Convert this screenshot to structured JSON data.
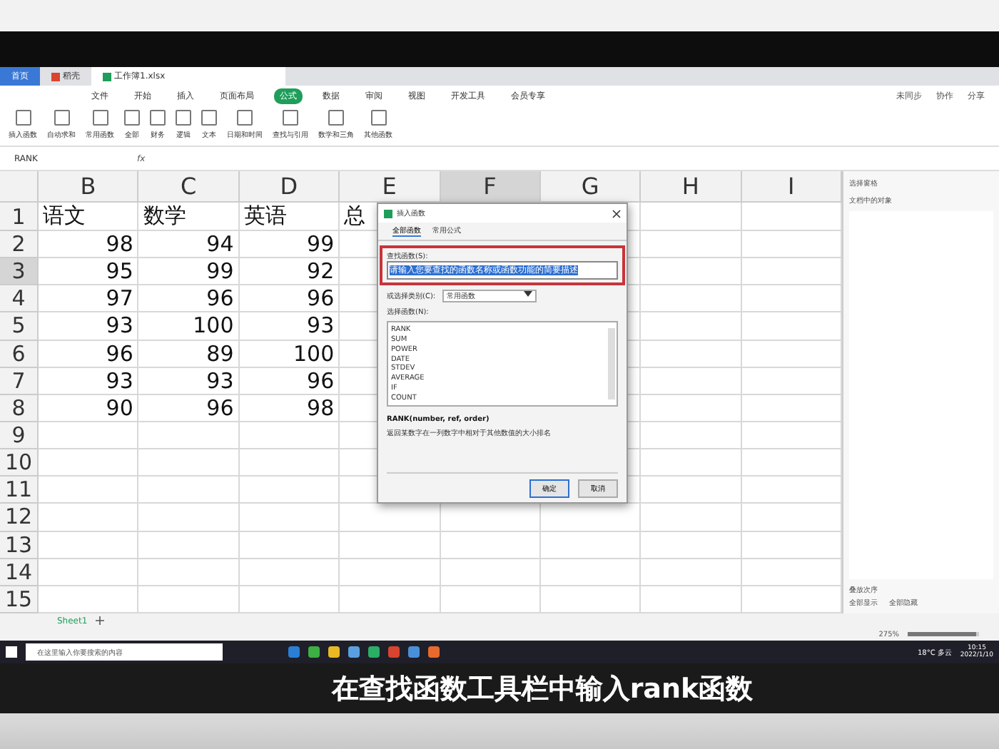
{
  "app_tabs": [
    {
      "label": "首页",
      "selected": false,
      "kind": "home"
    },
    {
      "label": "稻壳",
      "selected": false,
      "kind": "doc"
    },
    {
      "label": "工作簿1.xlsx",
      "selected": true,
      "kind": "sheet"
    }
  ],
  "menu": [
    {
      "label": "文件",
      "selected": false
    },
    {
      "label": "开始",
      "selected": false
    },
    {
      "label": "插入",
      "selected": false
    },
    {
      "label": "页面布局",
      "selected": false
    },
    {
      "label": "公式",
      "selected": true
    },
    {
      "label": "数据",
      "selected": false
    },
    {
      "label": "审阅",
      "selected": false
    },
    {
      "label": "视图",
      "selected": false
    },
    {
      "label": "开发工具",
      "selected": false
    },
    {
      "label": "会员专享",
      "selected": false
    }
  ],
  "menu_right": [
    "未同步",
    "协作",
    "分享"
  ],
  "ribbon": [
    "插入函数",
    "自动求和",
    "常用函数",
    "全部",
    "财务",
    "逻辑",
    "文本",
    "日期和时间",
    "查找与引用",
    "数学和三角",
    "其他函数"
  ],
  "formula_bar": {
    "name_box": "RANK",
    "fx": "fx"
  },
  "sheet": {
    "columns": [
      {
        "label": "B",
        "selected": false
      },
      {
        "label": "C",
        "selected": false
      },
      {
        "label": "D",
        "selected": false
      },
      {
        "label": "E",
        "selected": false
      },
      {
        "label": "F",
        "selected": true
      },
      {
        "label": "G",
        "selected": false
      },
      {
        "label": "H",
        "selected": false
      },
      {
        "label": "I",
        "selected": false
      }
    ],
    "rows": [
      {
        "header": "1",
        "selected": false,
        "cells": [
          "语文",
          "数学",
          "英语",
          "总"
        ]
      },
      {
        "header": "2",
        "selected": false,
        "cells": [
          "98",
          "94",
          "99"
        ]
      },
      {
        "header": "3",
        "selected": true,
        "cells": [
          "95",
          "99",
          "92"
        ]
      },
      {
        "header": "4",
        "selected": false,
        "cells": [
          "97",
          "96",
          "96"
        ]
      },
      {
        "header": "5",
        "selected": false,
        "cells": [
          "93",
          "100",
          "93"
        ]
      },
      {
        "header": "6",
        "selected": false,
        "cells": [
          "96",
          "89",
          "100"
        ]
      },
      {
        "header": "7",
        "selected": false,
        "cells": [
          "93",
          "93",
          "96"
        ]
      },
      {
        "header": "8",
        "selected": false,
        "cells": [
          "90",
          "96",
          "98"
        ]
      },
      {
        "header": "9",
        "selected": false,
        "cells": []
      },
      {
        "header": "10",
        "selected": false,
        "cells": []
      },
      {
        "header": "11",
        "selected": false,
        "cells": []
      },
      {
        "header": "12",
        "selected": false,
        "cells": []
      },
      {
        "header": "13",
        "selected": false,
        "cells": []
      },
      {
        "header": "14",
        "selected": false,
        "cells": []
      },
      {
        "header": "15",
        "selected": false,
        "cells": []
      }
    ]
  },
  "dialog": {
    "title": "插入函数",
    "tabs": [
      {
        "label": "全部函数",
        "selected": true
      },
      {
        "label": "常用公式",
        "selected": false
      }
    ],
    "search_label": "查找函数(S):",
    "search_value": "请输入您要查找的函数名称或函数功能的简要描述",
    "category_label": "或选择类别(C):",
    "category_value": "常用函数",
    "list_label": "选择函数(N):",
    "functions": [
      {
        "label": "RANK",
        "selected": false
      },
      {
        "label": "SUM",
        "selected": false
      },
      {
        "label": "POWER",
        "selected": false
      },
      {
        "label": "DATE",
        "selected": false
      },
      {
        "label": "STDEV",
        "selected": false
      },
      {
        "label": "AVERAGE",
        "selected": false
      },
      {
        "label": "IF",
        "selected": false
      },
      {
        "label": "COUNT",
        "selected": false
      }
    ],
    "signature": "RANK(number, ref, order)",
    "description": "返回某数字在一列数字中相对于其他数值的大小排名",
    "buttons": [
      {
        "label": "确定",
        "default": true
      },
      {
        "label": "取消",
        "default": false
      }
    ]
  },
  "side_panel": {
    "title": "选择窗格",
    "subtitle": "文档中的对象",
    "footer": "叠放次序",
    "buttons": [
      "全部显示",
      "全部隐藏"
    ]
  },
  "sheet_tabs": [
    {
      "label": "Sheet1",
      "selected": true
    }
  ],
  "status_bar": {
    "zoom": "275%",
    "zoom_slider": {
      "level": 0.95
    }
  },
  "taskbar": {
    "search_placeholder": "在这里输入你要搜索的内容",
    "weather": "18°C 多云",
    "time": "10:15",
    "date": "2022/1/10"
  },
  "caption": "在查找函数工具栏中输入rank函数"
}
